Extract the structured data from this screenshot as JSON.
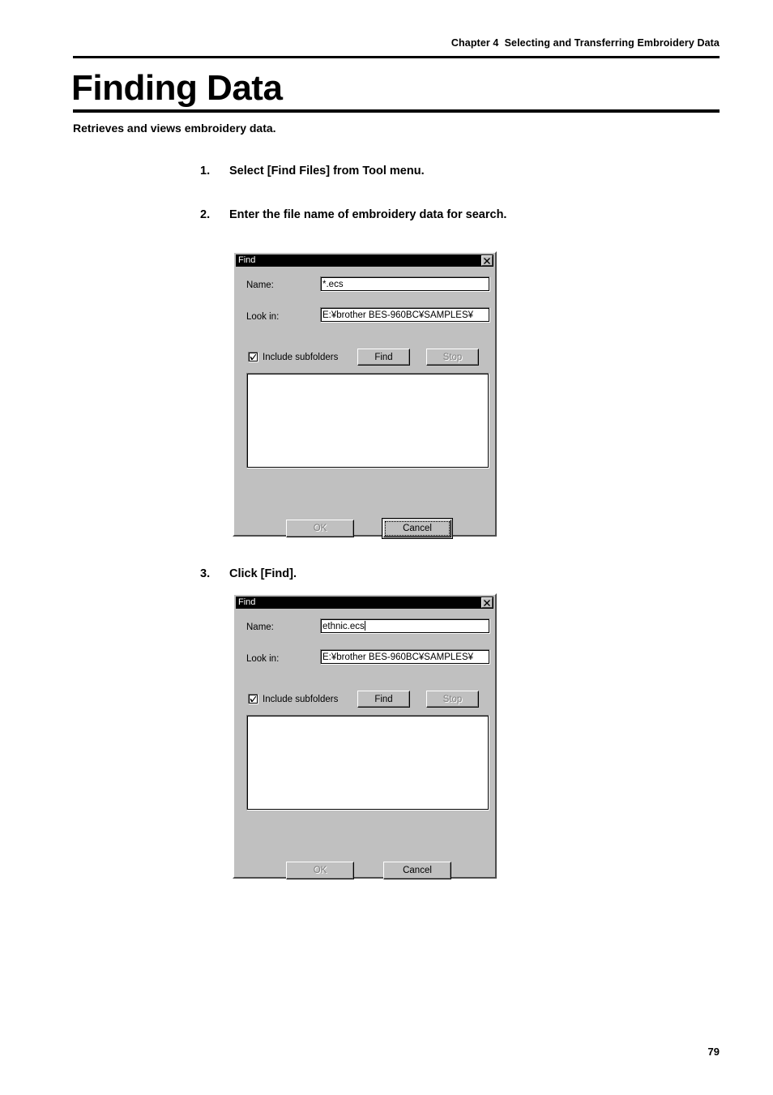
{
  "header": {
    "running_head": "Chapter 4  Selecting and Transferring Embroidery Data"
  },
  "title": "Finding Data",
  "subtitle": "Retrieves and views embroidery data.",
  "steps": [
    {
      "num": "1.",
      "text": "Select [Find Files] from Tool menu."
    },
    {
      "num": "2.",
      "text": "Enter the file name of embroidery data for search."
    },
    {
      "num": "3.",
      "text": "Click [Find]."
    }
  ],
  "dialog_1": {
    "title": "Find",
    "close_icon": "close-icon",
    "name_label": "Name:",
    "name_value": "*.ecs",
    "lookin_label": "Look in:",
    "lookin_value": "E:¥brother BES-960BC¥SAMPLES¥",
    "checkbox_label": "Include subfolders",
    "checkbox_checked": "checked",
    "find_label": "Find",
    "stop_label": "Stop",
    "ok_label": "OK",
    "cancel_label": "Cancel",
    "results": []
  },
  "dialog_2": {
    "title": "Find",
    "close_icon": "close-icon",
    "name_label": "Name:",
    "name_value": "ethnic.ecs",
    "lookin_label": "Look in:",
    "lookin_value": "E:¥brother BES-960BC¥SAMPLES¥",
    "checkbox_label": "Include subfolders",
    "checkbox_checked": "checked",
    "find_label": "Find",
    "stop_label": "Stop",
    "ok_label": "OK",
    "cancel_label": "Cancel",
    "results": []
  },
  "footer": {
    "page_number": "79"
  },
  "colors": {
    "dialog_face": "#c0c0c0",
    "titlebar": "#000000",
    "titlebar_text": "#ffffff",
    "disabled_text": "#808080",
    "field_bg": "#ffffff",
    "page_bg": "#ffffff",
    "ink": "#000000"
  }
}
